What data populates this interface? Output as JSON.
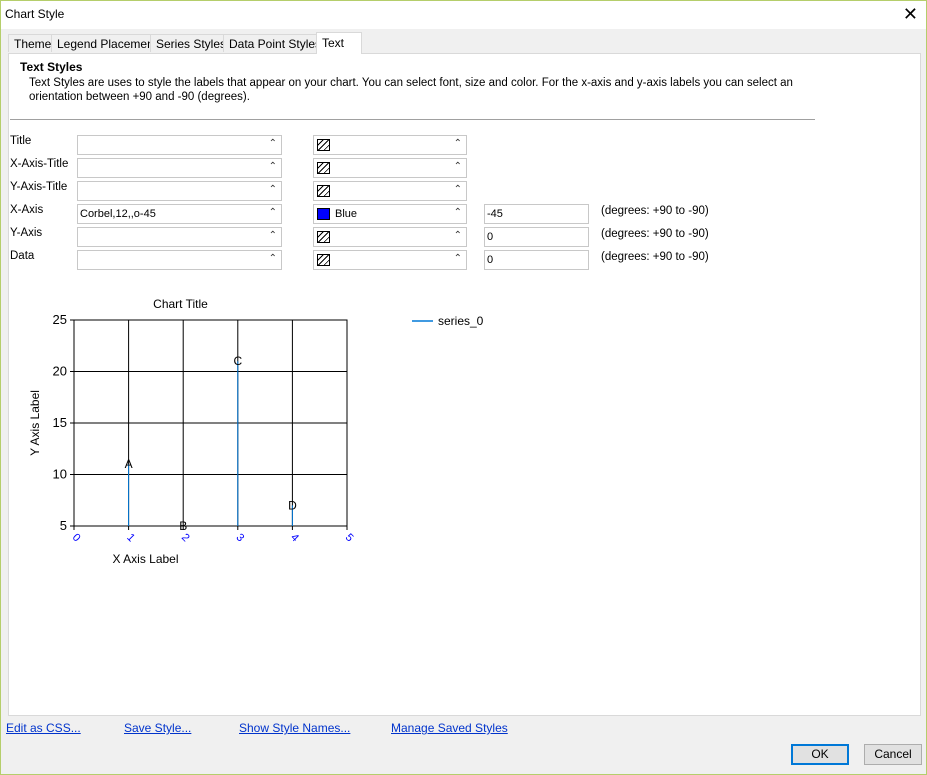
{
  "window": {
    "title": "Chart Style",
    "close_glyph": "✕"
  },
  "tabs": [
    "Theme",
    "Legend Placement",
    "Series Styles",
    "Data Point Styles",
    "Text"
  ],
  "active_tab": "Text",
  "section": {
    "heading": "Text Styles",
    "description": "Text Styles are uses to style the labels that appear on your chart. You can select font, size and color. For the x-axis and y-axis labels you can select an orientation between +90 and -90 (degrees)."
  },
  "rows": [
    {
      "label": "Title",
      "font": "",
      "color": "",
      "color_swatch": "none"
    },
    {
      "label": "X-Axis-Title",
      "font": "",
      "color": "",
      "color_swatch": "none"
    },
    {
      "label": "Y-Axis-Title",
      "font": "",
      "color": "",
      "color_swatch": "none"
    },
    {
      "label": "X-Axis",
      "font": "Corbel,12,,o-45",
      "color": "Blue",
      "color_swatch": "#0000ff",
      "orientation": "-45",
      "hint": "(degrees: +90 to -90)"
    },
    {
      "label": "Y-Axis",
      "font": "",
      "color": "",
      "color_swatch": "none",
      "orientation": "0",
      "hint": "(degrees: +90 to -90)"
    },
    {
      "label": "Data",
      "font": "",
      "color": "",
      "color_swatch": "none",
      "orientation": "0",
      "hint": "(degrees: +90 to -90)"
    }
  ],
  "chart_data": {
    "type": "bar",
    "title": "Chart Title",
    "xlabel": "X Axis Label",
    "ylabel": "Y Axis Label",
    "xlim": [
      0,
      5
    ],
    "ylim": [
      5,
      25
    ],
    "xticks": [
      "0",
      "1",
      "2",
      "3",
      "4",
      "5"
    ],
    "yticks": [
      "5",
      "10",
      "15",
      "20",
      "25"
    ],
    "grid": true,
    "legend": "right",
    "series": [
      {
        "name": "series_0",
        "color": "#0078d7",
        "x": [
          1,
          2,
          3,
          4
        ],
        "y": [
          11,
          5,
          21,
          7
        ],
        "labels": [
          "A",
          "B",
          "C",
          "D"
        ]
      }
    ],
    "tick_label_color": "#0000ff"
  },
  "links": [
    "Edit as CSS...",
    "Save Style...",
    "Show Style Names...",
    "Manage Saved Styles"
  ],
  "buttons": {
    "ok": "OK",
    "cancel": "Cancel"
  },
  "icons": {
    "combo_arrow": "⌃"
  }
}
